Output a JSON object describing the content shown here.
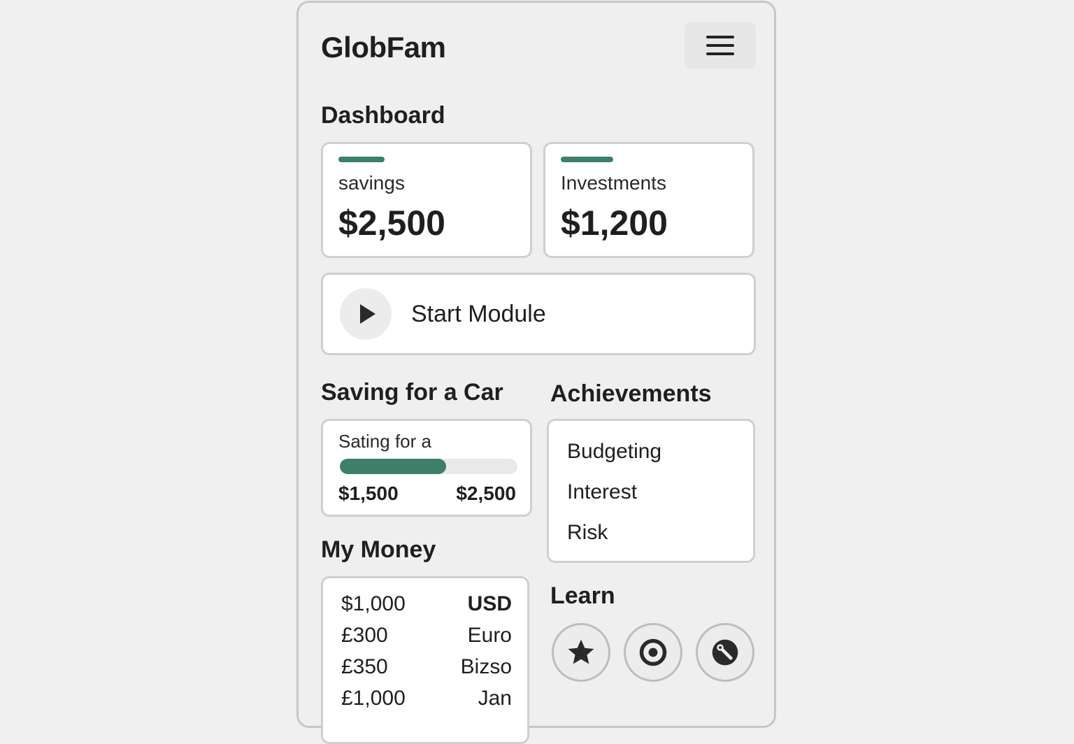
{
  "app": {
    "title": "GlobFam",
    "menu_icon": "hamburger-menu-icon"
  },
  "dashboard": {
    "title": "Dashboard",
    "accent_color": "#3d7f69",
    "cards": [
      {
        "label": "savings",
        "value": "$2,500"
      },
      {
        "label": "Investments",
        "value": "$1,200"
      }
    ]
  },
  "module": {
    "label": "Start Module",
    "icon": "play-icon"
  },
  "goal": {
    "title": "Saving for a Car",
    "label": "Sating for a",
    "current": "$1,500",
    "target": "$2,500",
    "progress": 0.6
  },
  "achievements": {
    "title": "Achievements",
    "items": [
      "Budgeting",
      "Interest",
      "Risk"
    ]
  },
  "my_money": {
    "title": "My Money",
    "rows": [
      {
        "amount": "$1,000",
        "currency": "USD"
      },
      {
        "amount": "£300",
        "currency": "Euro"
      },
      {
        "amount": "£350",
        "currency": "Bizso"
      },
      {
        "amount": "£1,000",
        "currency": "Jan"
      }
    ]
  },
  "learn": {
    "title": "Learn",
    "icons": [
      "star-icon",
      "target-icon",
      "tools-icon"
    ]
  }
}
